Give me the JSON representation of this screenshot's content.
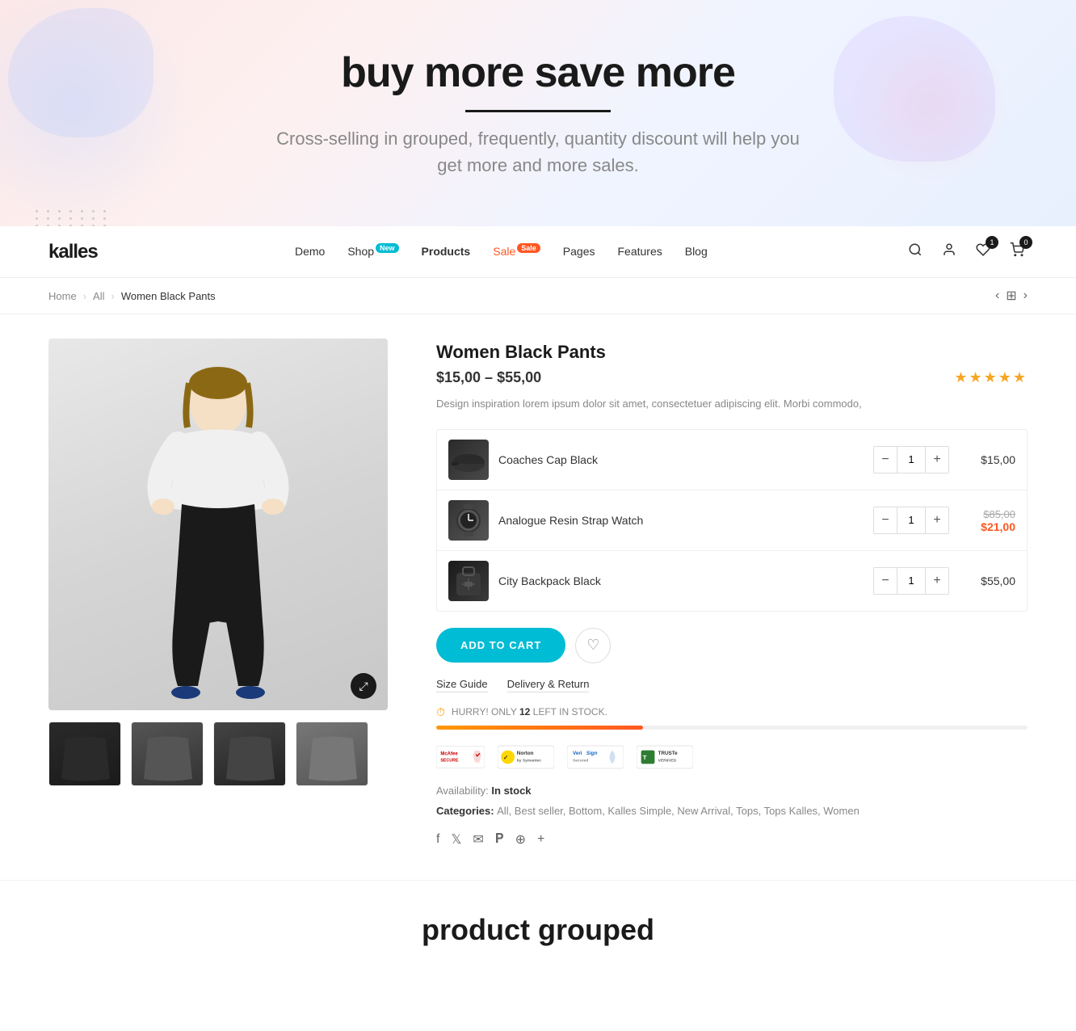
{
  "hero": {
    "title": "buy more save more",
    "subtitle": "Cross-selling in grouped, frequently,  quantity discount will help you get more and more sales."
  },
  "navbar": {
    "logo": "kalles",
    "nav_items": [
      {
        "label": "Demo",
        "badge": null
      },
      {
        "label": "Shop",
        "badge": "New"
      },
      {
        "label": "Products",
        "badge": null
      },
      {
        "label": "Sale",
        "badge": "Sale",
        "highlight": true
      },
      {
        "label": "Pages",
        "badge": null
      },
      {
        "label": "Features",
        "badge": null
      },
      {
        "label": "Blog",
        "badge": null
      }
    ],
    "cart_count": "0",
    "wishlist_count": "1"
  },
  "breadcrumb": {
    "home": "Home",
    "all": "All",
    "current": "Women Black Pants"
  },
  "product": {
    "title": "Women Black Pants",
    "price": "$15,00 – $55,00",
    "stars": "★★★★★",
    "description": "Design inspiration lorem ipsum dolor sit amet, consectetuer adipiscing elit. Morbi commodo,",
    "items": [
      {
        "name": "Coaches Cap Black",
        "qty": 1,
        "price": "$15,00",
        "original_price": null,
        "sale_price": null
      },
      {
        "name": "Analogue Resin Strap Watch",
        "qty": 1,
        "price": "$21,00",
        "original_price": "$85,00",
        "sale_price": "$21,00"
      },
      {
        "name": "City Backpack Black",
        "qty": 1,
        "price": "$55,00",
        "original_price": null,
        "sale_price": null
      }
    ],
    "add_to_cart": "ADD TO CART",
    "size_guide": "Size Guide",
    "delivery": "Delivery & Return",
    "stock_msg": "HURRY! ONLY",
    "stock_count": "12",
    "stock_unit": "LEFT IN STOCK.",
    "availability": "In stock",
    "categories": "All, Best seller, Bottom, Kalles Simple, New Arrival, Tops, Tops Kalles, Women"
  },
  "footer": {
    "section_title": "product grouped"
  }
}
